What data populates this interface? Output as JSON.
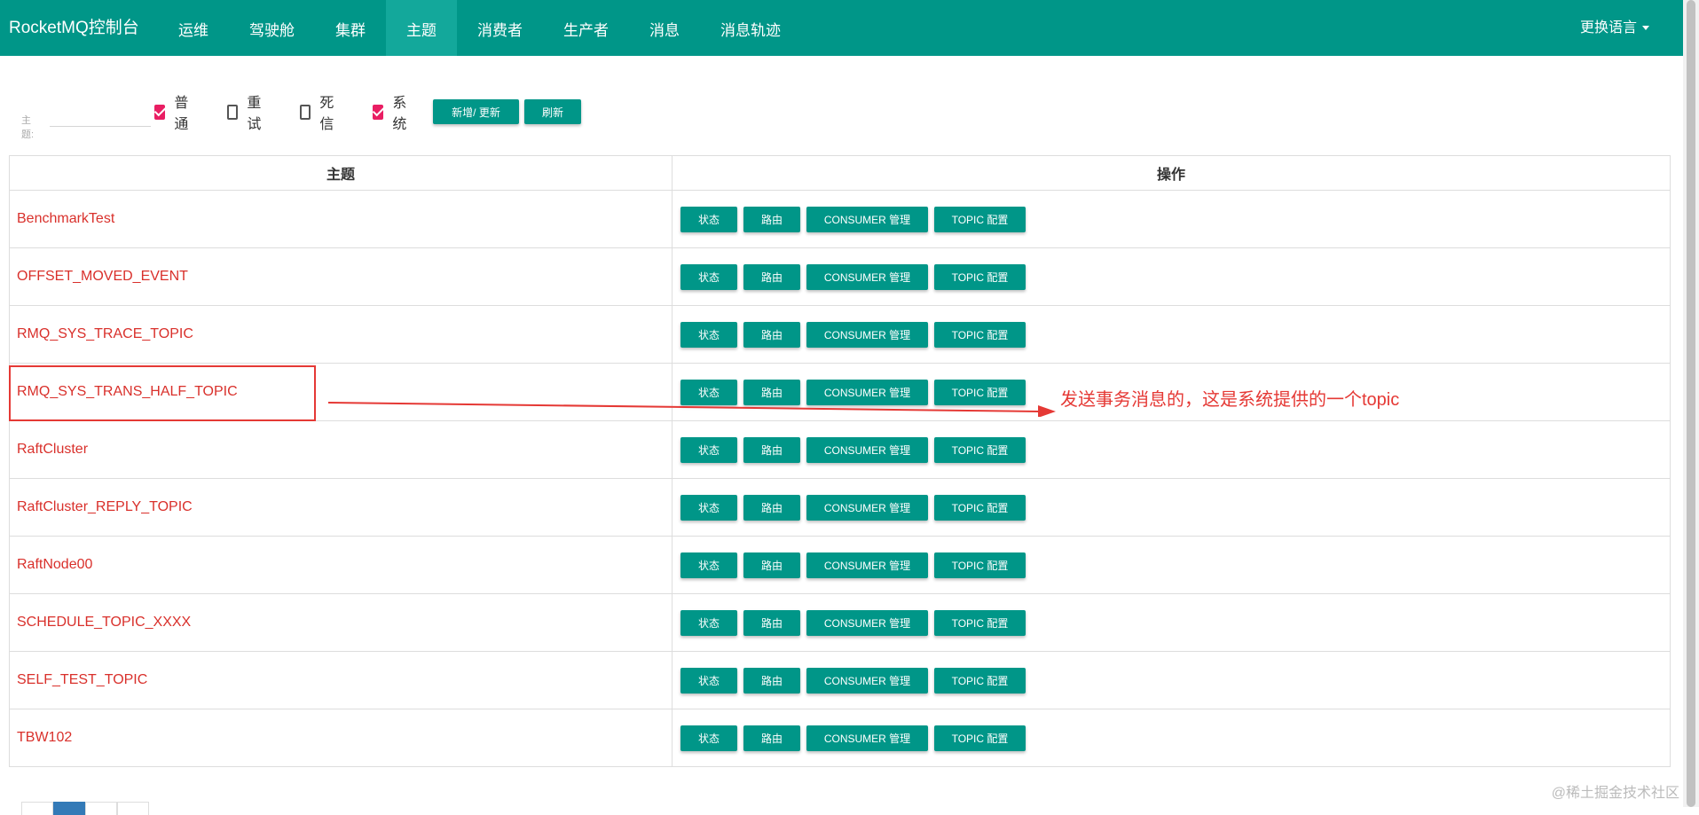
{
  "nav": {
    "brand": "RocketMQ控制台",
    "items": [
      "运维",
      "驾驶舱",
      "集群",
      "主题",
      "消费者",
      "生产者",
      "消息",
      "消息轨迹"
    ],
    "active_index": 3,
    "language": "更换语言"
  },
  "filter": {
    "topic_label": "主题:",
    "topic_value": "",
    "checkboxes": [
      {
        "label": "普通",
        "checked": true
      },
      {
        "label": "重试",
        "checked": false
      },
      {
        "label": "死信",
        "checked": false
      },
      {
        "label": "系统",
        "checked": true
      }
    ],
    "add_update_label": "新增/ 更新",
    "refresh_label": "刷新"
  },
  "table": {
    "headers": {
      "topic": "主题",
      "operation": "操作"
    },
    "op_labels": {
      "status": "状态",
      "route": "路由",
      "consumer": "CONSUMER 管理",
      "topic_config": "TOPIC 配置"
    },
    "rows": [
      "BenchmarkTest",
      "OFFSET_MOVED_EVENT",
      "RMQ_SYS_TRACE_TOPIC",
      "RMQ_SYS_TRANS_HALF_TOPIC",
      "RaftCluster",
      "RaftCluster_REPLY_TOPIC",
      "RaftNode00",
      "SCHEDULE_TOPIC_XXXX",
      "SELF_TEST_TOPIC",
      "TBW102"
    ]
  },
  "annotation": {
    "text": "发送事务消息的，这是系统提供的一个topic",
    "color": "#e53935"
  },
  "colors": {
    "primary": "#009688",
    "topic_link": "#d9302b",
    "checkbox_checked": "#e91e63"
  },
  "watermark": "@稀土掘金技术社区"
}
